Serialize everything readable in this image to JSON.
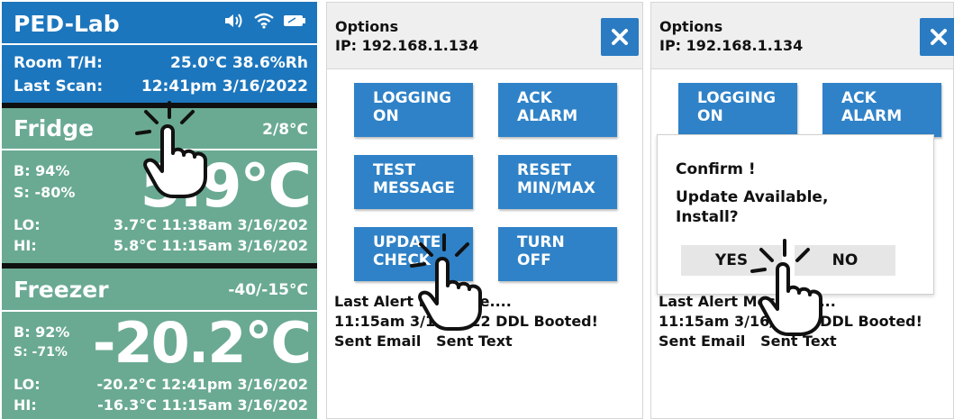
{
  "dashboard": {
    "brand": "PED-Lab",
    "status_icons": [
      "speaker-icon",
      "wifi-icon",
      "battery-icon"
    ],
    "room_label": "Room T/H:",
    "room_value": "25.0°C 38.6%Rh",
    "scan_label": "Last Scan:",
    "scan_value": "12:41pm 3/16/2022",
    "fridge": {
      "title": "Fridge",
      "range": "2/8°C",
      "battery": "B: 94%",
      "signal": "S: -80%",
      "temp": "5.9°C",
      "lo_label": "LO:",
      "lo_value": "3.7°C 11:38am 3/16/202",
      "hi_label": "HI:",
      "hi_value": "5.8°C 11:15am 3/16/202"
    },
    "freezer": {
      "title": "Freezer",
      "range": "-40/-15°C",
      "battery": "B: 92%",
      "signal": "S: -71%",
      "temp": "-20.2°C",
      "lo_label": "LO:",
      "lo_value": "-20.2°C 12:41pm 3/16/202",
      "hi_label": "HI:",
      "hi_value": "-16.3°C 11:15am 3/16/202"
    }
  },
  "options": {
    "title": "Options",
    "ip": "IP: 192.168.1.134",
    "buttons": {
      "logging": [
        "LOGGING",
        "ON"
      ],
      "ack": [
        "ACK",
        "ALARM"
      ],
      "test": [
        "TEST",
        "MESSAGE"
      ],
      "reset": [
        "RESET",
        "MIN/MAX"
      ],
      "update": [
        "UPDATE",
        "CHECK"
      ],
      "turn_off": [
        "TURN",
        "OFF"
      ]
    },
    "alert_line1": "Last Alert Message....",
    "alert_line2": "11:15am 3/16/2022 DDL Booted!",
    "alert_line3": "Sent Email   Sent Text"
  },
  "dialog": {
    "title": "Confirm !",
    "message": "Update Available, Install?",
    "yes": "YES",
    "no": "NO"
  },
  "colors": {
    "header_blue": "#1c76bd",
    "section_green": "#6aaa92",
    "button_blue": "#2f82c7"
  }
}
